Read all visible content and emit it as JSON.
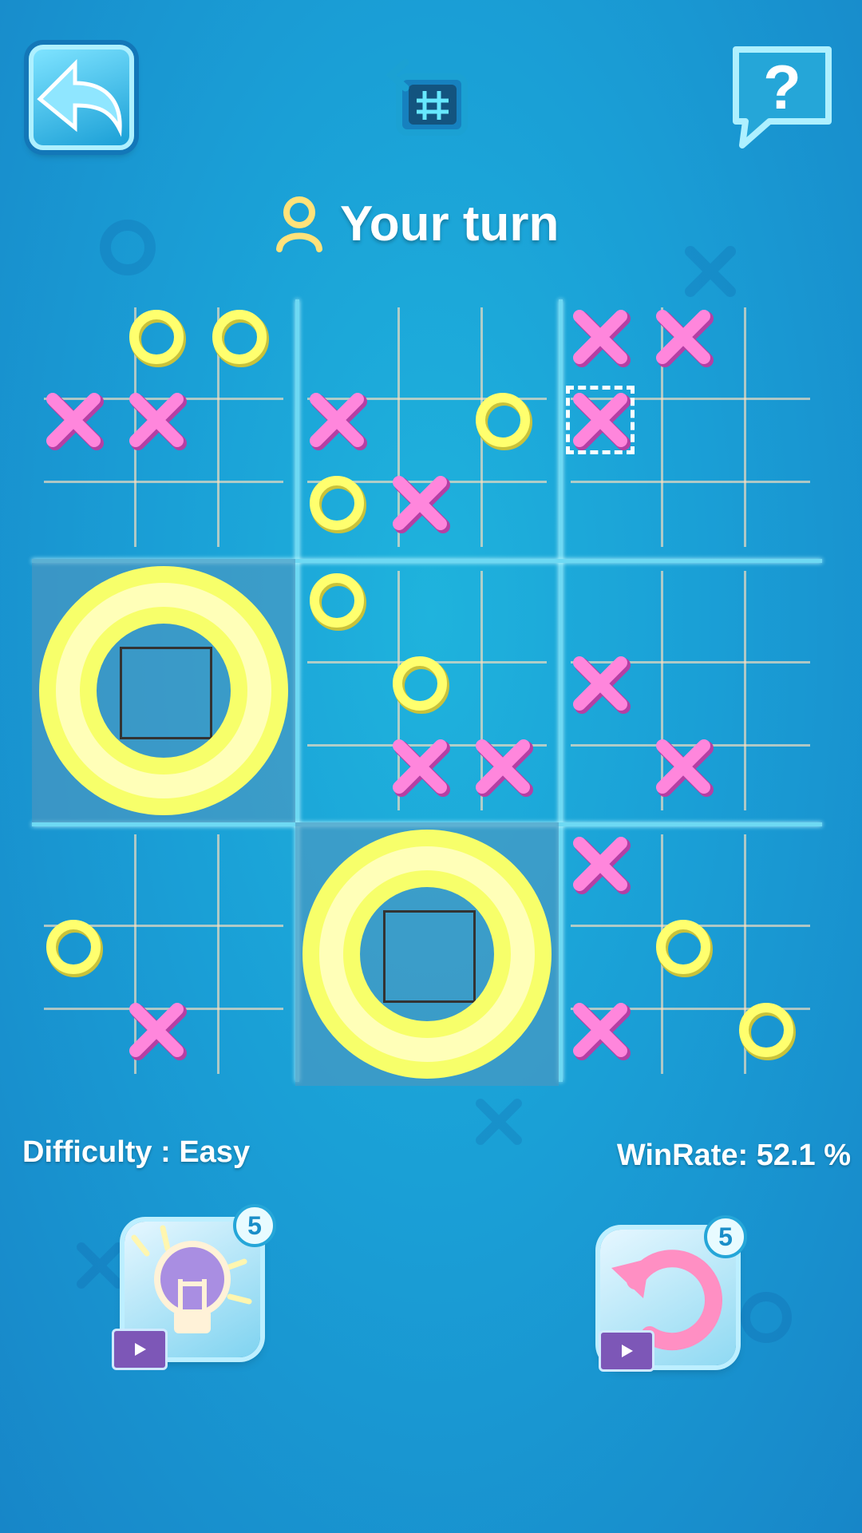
{
  "status": {
    "turn_text": "Your turn"
  },
  "icons": {
    "back": "back-arrow-icon",
    "board_switch": "board-grid-icon",
    "help": "help-question-icon",
    "player": "player-icon",
    "hint": "lightbulb-icon",
    "undo": "undo-icon",
    "video": "video-ad-icon"
  },
  "colors": {
    "x_mark": "#ff7fd8",
    "o_mark": "#ffff66",
    "background": "#1a9fd6"
  },
  "board": [
    [
      "O",
      "O",
      "",
      "X",
      "X",
      "",
      "",
      "",
      ""
    ],
    [
      "",
      "",
      "",
      "X",
      "",
      "O",
      "O",
      "X",
      ""
    ],
    [
      "X",
      "X",
      "",
      "X",
      "",
      "",
      "",
      "",
      ""
    ],
    [
      "",
      "",
      "",
      "O",
      "",
      "",
      "",
      "",
      ""
    ],
    [
      "",
      "",
      "",
      "",
      "O",
      "",
      "",
      "",
      ""
    ],
    [
      "",
      "",
      "",
      "",
      "",
      "X",
      "X",
      "",
      "X"
    ]
  ],
  "big_board": {
    "cells": [
      [
        "",
        "",
        "",
        "",
        "",
        "",
        "",
        "",
        ""
      ],
      [
        "",
        "",
        "",
        "",
        "",
        "",
        "",
        "",
        ""
      ],
      [
        "",
        "",
        "",
        "",
        "",
        "",
        "",
        "",
        ""
      ],
      [
        "",
        "",
        "",
        "",
        "",
        "",
        "",
        "",
        ""
      ],
      [
        "",
        "",
        "",
        "",
        "",
        "",
        "",
        "",
        ""
      ],
      [
        "",
        "",
        "",
        "",
        "",
        "",
        "",
        "",
        ""
      ],
      [
        "",
        "",
        "",
        "",
        "",
        "",
        "",
        "",
        ""
      ],
      [
        "",
        "",
        "",
        "",
        "",
        "",
        "",
        "",
        ""
      ],
      [
        "",
        "",
        "",
        "",
        "",
        "",
        "",
        "",
        ""
      ]
    ],
    "sub_boards": [
      {
        "won_by": "",
        "cells": [
          "",
          "O",
          "O",
          "X",
          "X",
          "",
          "",
          "",
          ""
        ]
      },
      {
        "won_by": "",
        "cells": [
          "",
          "",
          "",
          "X",
          "",
          "O",
          "O",
          "X",
          ""
        ]
      },
      {
        "won_by": "",
        "cells": [
          "X",
          "X",
          "",
          "X",
          "",
          "",
          "",
          "",
          ""
        ]
      },
      {
        "won_by": "O",
        "cells": [
          "",
          "",
          "",
          "",
          "",
          "",
          "",
          "",
          ""
        ]
      },
      {
        "won_by": "",
        "cells": [
          "O",
          "",
          "",
          "",
          "O",
          "",
          "",
          "X",
          "X"
        ]
      },
      {
        "won_by": "",
        "cells": [
          "",
          "",
          "",
          "X",
          "",
          "",
          "",
          "X",
          ""
        ]
      },
      {
        "won_by": "",
        "cells": [
          "",
          "",
          "",
          "O",
          "",
          "",
          "",
          "X",
          ""
        ]
      },
      {
        "won_by": "O",
        "cells": [
          "",
          "",
          "",
          "",
          "",
          "",
          "",
          "",
          ""
        ]
      },
      {
        "won_by": "",
        "cells": [
          "X",
          "",
          "",
          "",
          "O",
          "",
          "X",
          "",
          "O"
        ]
      }
    ],
    "highlighted": {
      "sub": 2,
      "cell": 3
    }
  },
  "footer": {
    "difficulty_label": "Difficulty : Easy",
    "winrate_label": "WinRate:  52.1 %"
  },
  "tools": {
    "hint_count": "5",
    "undo_count": "5"
  }
}
